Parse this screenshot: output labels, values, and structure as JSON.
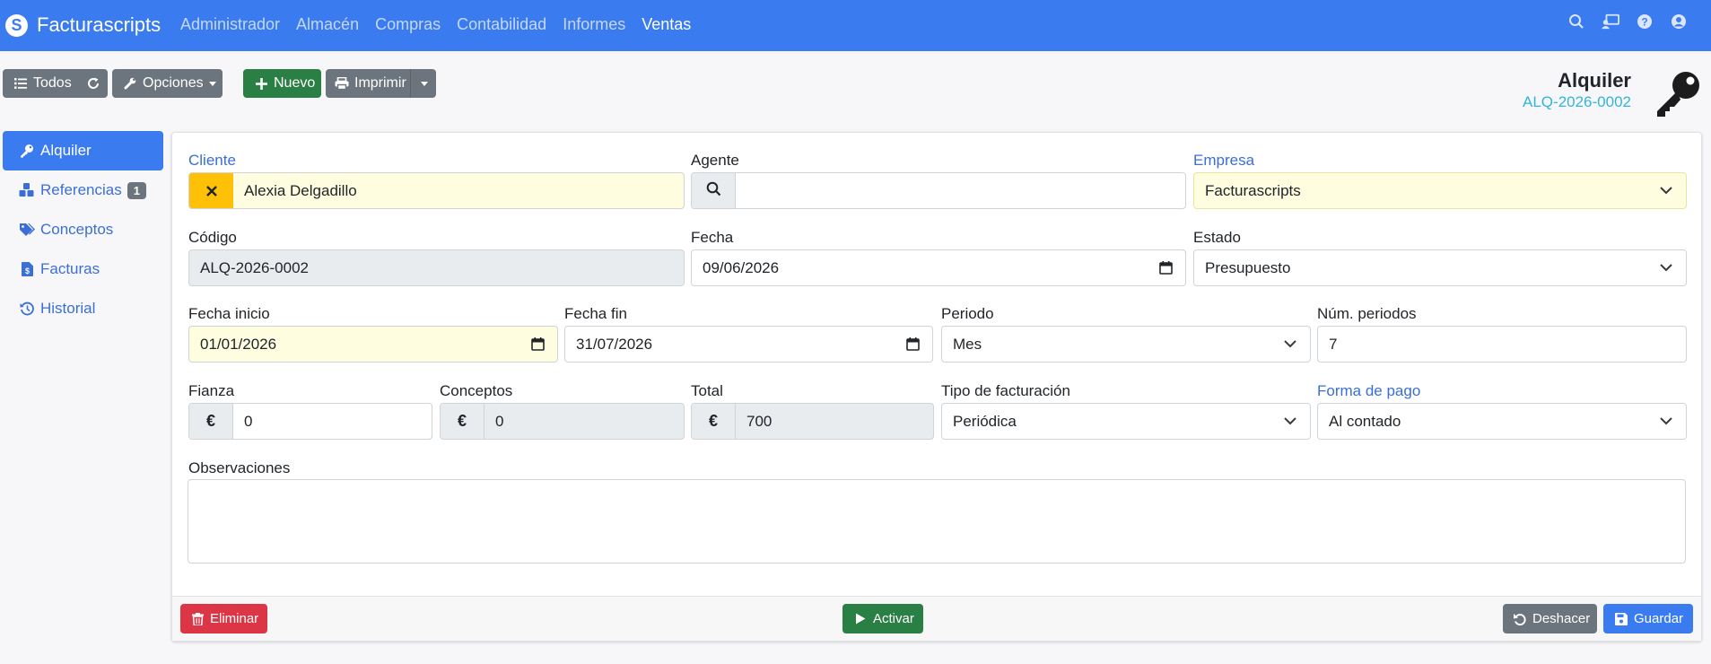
{
  "app": {
    "name": "Facturascripts"
  },
  "nav": {
    "menu": [
      "Administrador",
      "Almacén",
      "Compras",
      "Contabilidad",
      "Informes",
      "Ventas"
    ],
    "active_index": 5
  },
  "toolbar": {
    "todos": "Todos",
    "opciones": "Opciones",
    "nuevo": "Nuevo",
    "imprimir": "Imprimir"
  },
  "header": {
    "title": "Alquiler",
    "code": "ALQ-2026-0002"
  },
  "sidebar": {
    "items": [
      {
        "label": "Alquiler",
        "icon": "key-icon",
        "active": true
      },
      {
        "label": "Referencias",
        "icon": "cubes-icon",
        "badge": "1"
      },
      {
        "label": "Conceptos",
        "icon": "tags-icon"
      },
      {
        "label": "Facturas",
        "icon": "invoice-icon"
      },
      {
        "label": "Historial",
        "icon": "history-icon"
      }
    ]
  },
  "form": {
    "cliente": {
      "label": "Cliente",
      "value": "Alexia Delgadillo"
    },
    "agente": {
      "label": "Agente",
      "value": ""
    },
    "empresa": {
      "label": "Empresa",
      "value": "Facturascripts"
    },
    "codigo": {
      "label": "Código",
      "value": "ALQ-2026-0002"
    },
    "fecha": {
      "label": "Fecha",
      "value": "09/06/2026"
    },
    "estado": {
      "label": "Estado",
      "value": "Presupuesto"
    },
    "fecha_inicio": {
      "label": "Fecha inicio",
      "value": "01/01/2026"
    },
    "fecha_fin": {
      "label": "Fecha fin",
      "value": "31/07/2026"
    },
    "periodo": {
      "label": "Periodo",
      "value": "Mes"
    },
    "num_periodos": {
      "label": "Núm. periodos",
      "value": "7"
    },
    "fianza": {
      "label": "Fianza",
      "currency": "€",
      "value": "0"
    },
    "conceptos": {
      "label": "Conceptos",
      "currency": "€",
      "value": "0"
    },
    "total": {
      "label": "Total",
      "currency": "€",
      "value": "700"
    },
    "tipo_facturacion": {
      "label": "Tipo de facturación",
      "value": "Periódica"
    },
    "forma_pago": {
      "label": "Forma de pago",
      "value": "Al contado"
    },
    "observaciones": {
      "label": "Observaciones",
      "value": ""
    }
  },
  "footer": {
    "eliminar": "Eliminar",
    "activar": "Activar",
    "deshacer": "Deshacer",
    "guardar": "Guardar"
  },
  "colors": {
    "navbar": "#3b7bf0",
    "link": "#3b6fd6",
    "success": "#2a7f45",
    "danger": "#dc3545",
    "secondary": "#6c757d",
    "warning": "#ffc107",
    "code": "#33b5d8"
  }
}
